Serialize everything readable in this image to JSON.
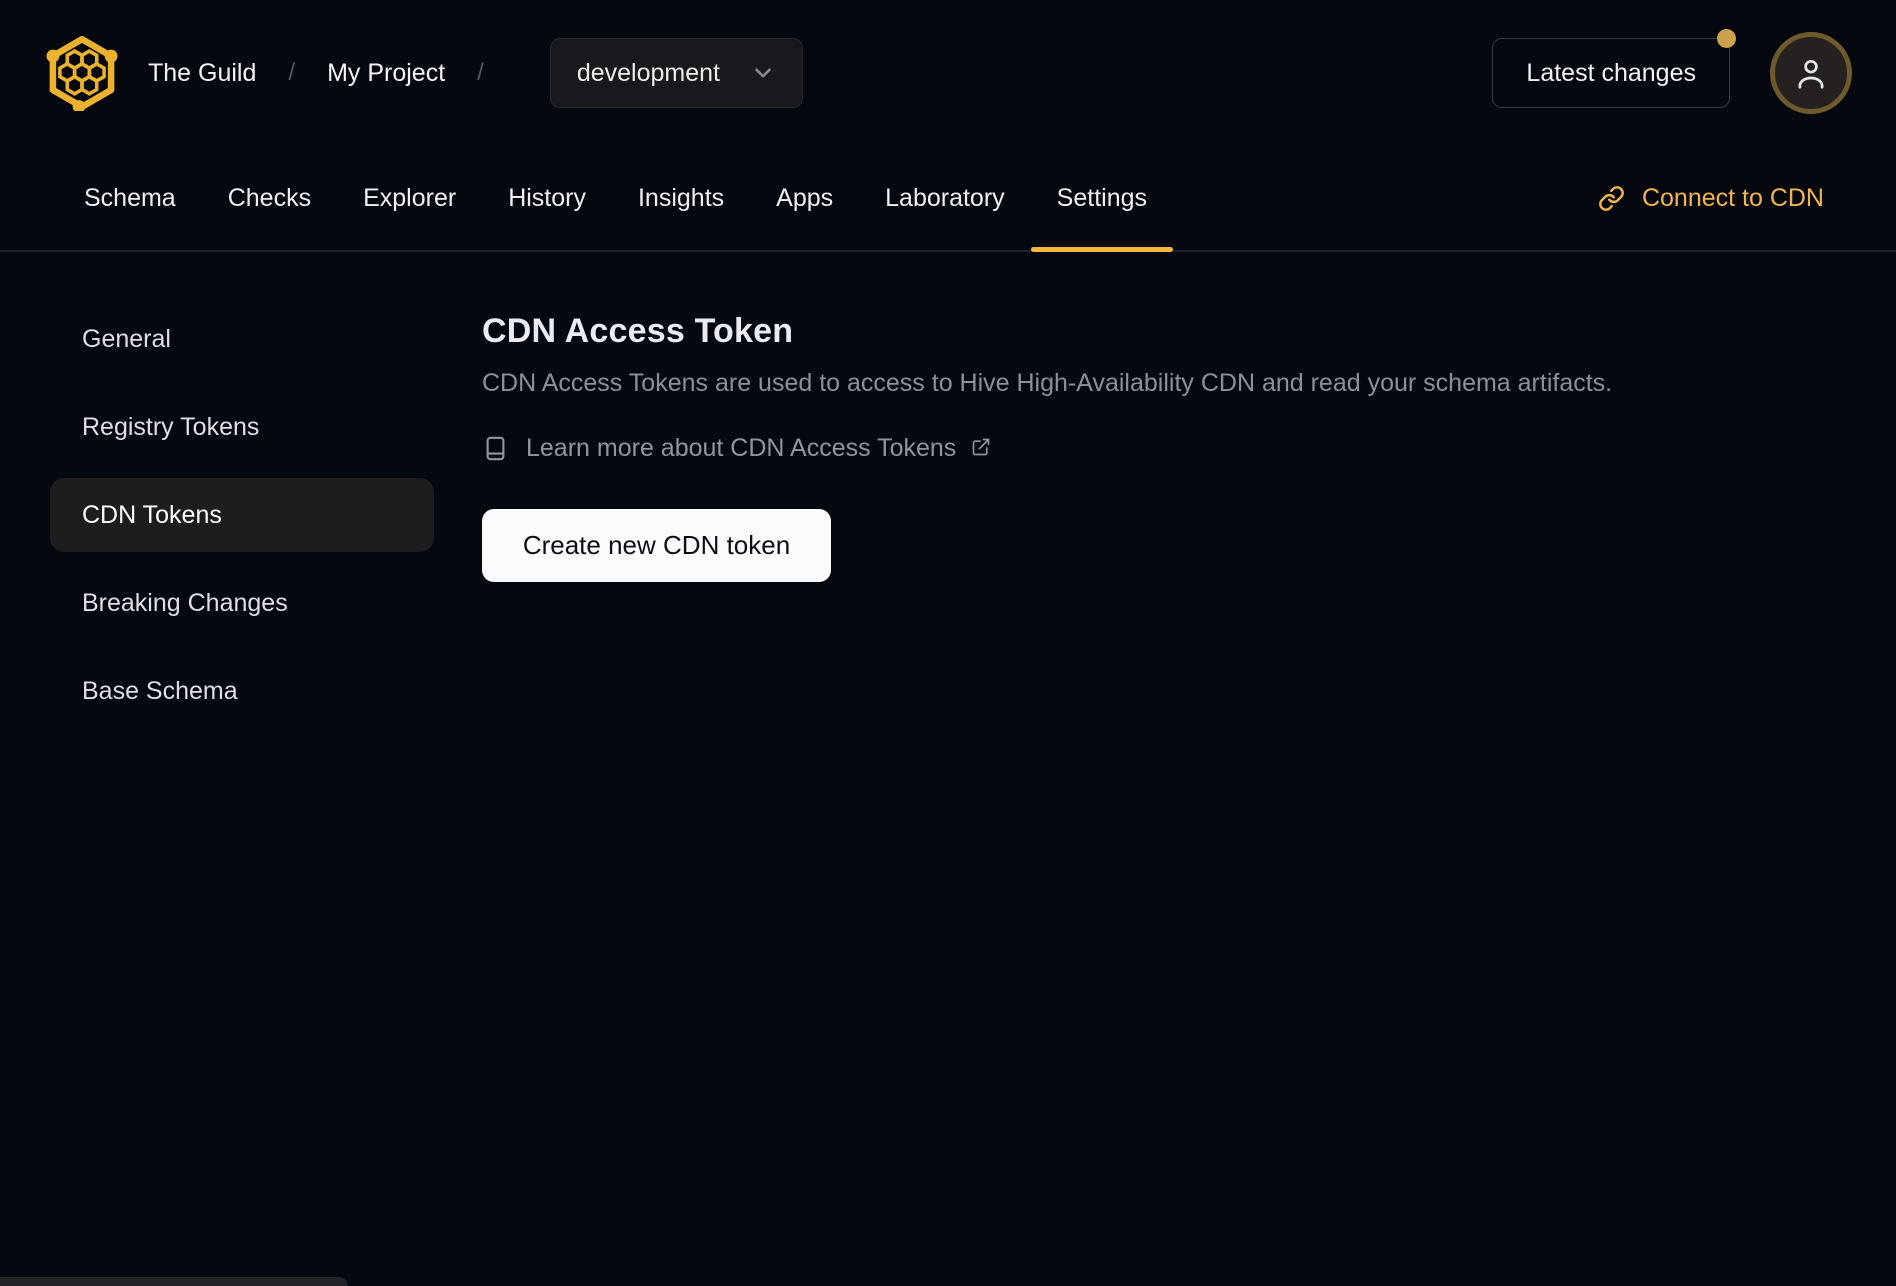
{
  "header": {
    "logo_icon": "hive-honeycomb-logo",
    "org": "The Guild",
    "project": "My Project",
    "breadcrumb_separator": "/",
    "target_selector": {
      "value": "development",
      "icon": "chevron-down-icon"
    },
    "latest_changes_label": "Latest changes",
    "notification_dot": true,
    "avatar_icon": "user-icon"
  },
  "nav": {
    "tabs": [
      {
        "label": "Schema",
        "active": false
      },
      {
        "label": "Checks",
        "active": false
      },
      {
        "label": "Explorer",
        "active": false
      },
      {
        "label": "History",
        "active": false
      },
      {
        "label": "Insights",
        "active": false
      },
      {
        "label": "Apps",
        "active": false
      },
      {
        "label": "Laboratory",
        "active": false
      },
      {
        "label": "Settings",
        "active": true
      }
    ],
    "cdn_link": {
      "label": "Connect to CDN",
      "icon": "link-icon"
    }
  },
  "sidebar": {
    "items": [
      {
        "label": "General",
        "active": false
      },
      {
        "label": "Registry Tokens",
        "active": false
      },
      {
        "label": "CDN Tokens",
        "active": true
      },
      {
        "label": "Breaking Changes",
        "active": false
      },
      {
        "label": "Base Schema",
        "active": false
      }
    ]
  },
  "main": {
    "title": "CDN Access Token",
    "description": "CDN Access Tokens are used to access to Hive High-Availability CDN and read your schema artifacts.",
    "learn_more": {
      "label": "Learn more about CDN Access Tokens",
      "leading_icon": "book-icon",
      "trailing_icon": "external-link-icon"
    },
    "create_button_label": "Create new CDN token"
  },
  "colors": {
    "background": "#05080f",
    "accent_gold": "#f4b740",
    "logo_gold": "#ecb22e",
    "panel_bg": "#19191d",
    "sidebar_active_bg": "#1d1d1f",
    "muted_text": "#8f9097",
    "button_bg": "#fbfbfd",
    "button_text": "#0c0e13",
    "notification_dot": "#c9a24a",
    "avatar_border": "#6e5a2b"
  }
}
